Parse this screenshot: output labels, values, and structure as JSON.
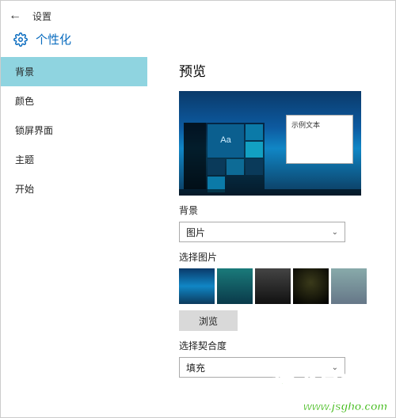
{
  "header": {
    "settings_label": "设置",
    "page_title": "个性化"
  },
  "sidebar": {
    "items": [
      {
        "label": "背景",
        "active": true
      },
      {
        "label": "颜色",
        "active": false
      },
      {
        "label": "锁屏界面",
        "active": false
      },
      {
        "label": "主题",
        "active": false
      },
      {
        "label": "开始",
        "active": false
      }
    ]
  },
  "content": {
    "preview_title": "预览",
    "sample_text_label": "示例文本",
    "background_label": "背景",
    "background_value": "图片",
    "choose_picture_label": "选择图片",
    "browse_label": "浏览",
    "fit_label": "选择契合度",
    "fit_value": "填充",
    "tile_aa": "Aa"
  },
  "watermark": {
    "big": "技术员联盟",
    "url": "www.jsgho.com"
  }
}
